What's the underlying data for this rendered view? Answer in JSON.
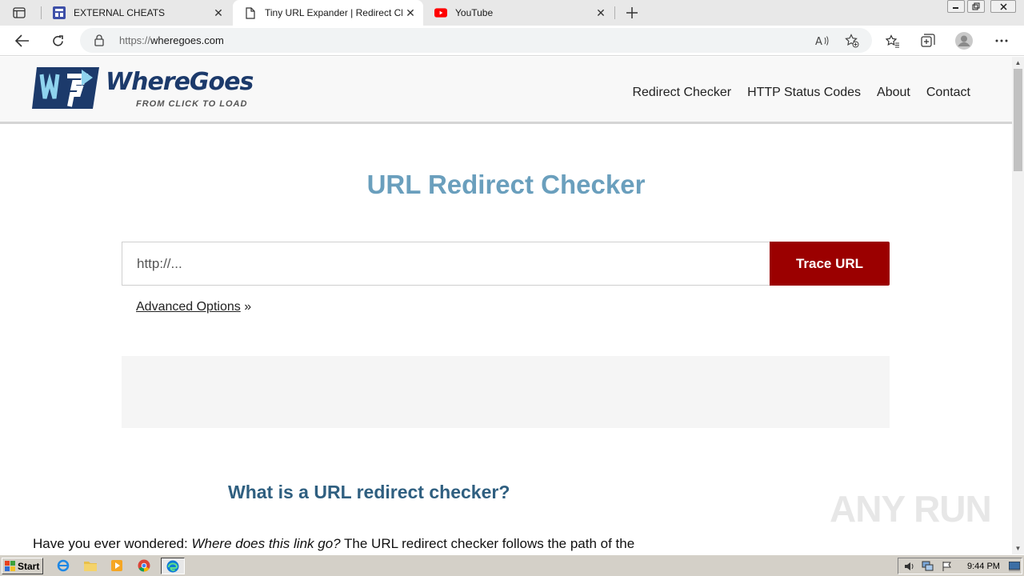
{
  "browser": {
    "tabs": [
      {
        "title": "EXTERNAL CHEATS",
        "active": false
      },
      {
        "title": "Tiny URL Expander | Redirect Ch",
        "active": true
      },
      {
        "title": "YouTube",
        "active": false
      }
    ],
    "address": {
      "scheme": "https://",
      "host": "wheregoes.com"
    },
    "accent_color": "#1a73e8"
  },
  "site": {
    "logo": {
      "brand": "WhereGoes",
      "tagline": "FROM CLICK TO LOAD"
    },
    "nav": [
      "Redirect Checker",
      "HTTP Status Codes",
      "About",
      "Contact"
    ],
    "hero_title": "URL Redirect Checker",
    "form": {
      "placeholder": "http://...",
      "button_label": "Trace URL"
    },
    "advanced": {
      "link": "Advanced Options",
      "suffix": " »"
    },
    "section_title": "What is a URL redirect checker?",
    "intro": {
      "lead": "Have you ever wondered: ",
      "emphasis": "Where does this link go?",
      "rest": " The URL redirect checker follows the path of the"
    },
    "colors": {
      "title": "#6a9fbd",
      "button": "#9b0000",
      "heading": "#2f5f80"
    }
  },
  "watermark": "ANY RUN",
  "taskbar": {
    "start_label": "Start",
    "clock": "9:44 PM"
  }
}
